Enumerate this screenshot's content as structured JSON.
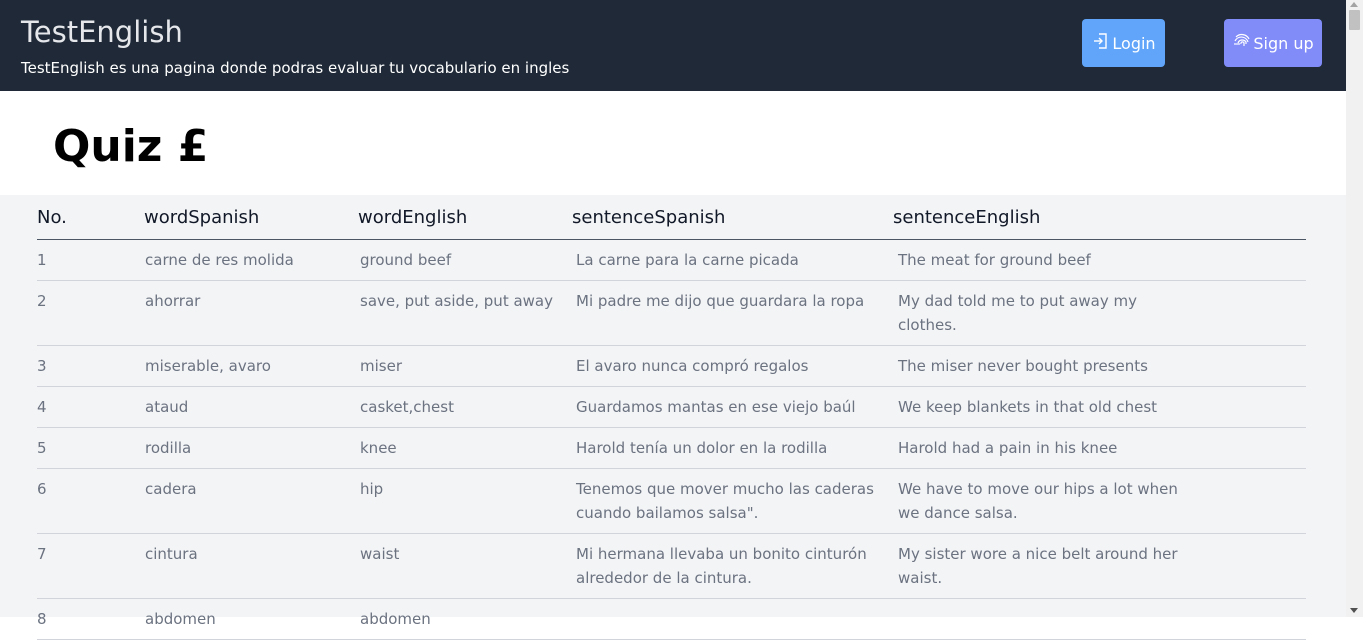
{
  "header": {
    "brand": "TestEnglish",
    "tagline": "TestEnglish es una pagina donde podras evaluar tu vocabulario en ingles",
    "login_label": "Login",
    "signup_label": "Sign up",
    "login_icon": "login-icon",
    "signup_icon": "fingerprint-icon"
  },
  "quiz": {
    "title": "Quiz £"
  },
  "table": {
    "headers": [
      "No.",
      "wordSpanish",
      "wordEnglish",
      "sentenceSpanish",
      "sentenceEnglish"
    ],
    "rows": [
      [
        "1",
        "carne de res molida",
        "ground beef",
        "La carne para la carne picada",
        "The meat for ground beef"
      ],
      [
        "2",
        "ahorrar",
        "save, put aside, put away",
        "Mi padre me dijo que guardara la ropa",
        "My dad told me to put away my clothes."
      ],
      [
        "3",
        "miserable, avaro",
        "miser",
        "El avaro nunca compró regalos",
        "The miser never bought presents"
      ],
      [
        "4",
        "ataud",
        "casket,chest",
        "Guardamos mantas en ese viejo baúl",
        "We keep blankets in that old chest"
      ],
      [
        "5",
        "rodilla",
        "knee",
        "Harold tenía un dolor en la rodilla",
        "Harold had a pain in his knee"
      ],
      [
        "6",
        "cadera",
        "hip",
        "Tenemos que mover mucho las caderas cuando bailamos salsa\".",
        "We have to move our hips a lot when we dance salsa."
      ],
      [
        "7",
        "cintura",
        "waist",
        "Mi hermana llevaba un bonito cinturón alrededor de la cintura.",
        "My sister wore a nice belt around her waist."
      ],
      [
        "8",
        "abdomen",
        "abdomen",
        "",
        ""
      ]
    ]
  },
  "colors": {
    "header_bg": "#1f2937",
    "login_bg": "#60a5fa",
    "signup_bg": "#818cf8",
    "table_bg": "#f3f4f6"
  }
}
